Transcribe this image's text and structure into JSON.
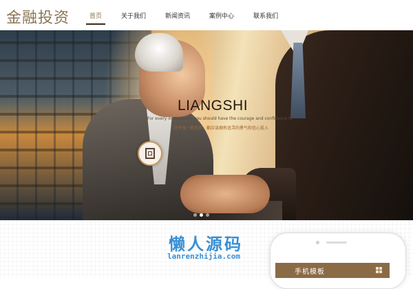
{
  "header": {
    "logo_text": "金融投资",
    "nav": [
      {
        "label": "首页",
        "active": true
      },
      {
        "label": "关于我们",
        "active": false
      },
      {
        "label": "新闻资讯",
        "active": false
      },
      {
        "label": "案例中心",
        "active": false
      },
      {
        "label": "联系我们",
        "active": false
      }
    ]
  },
  "banner": {
    "title": "LIANGSHI",
    "subtitle_en": "For every investment, you should have the courage and confidence to pur",
    "subtitle_cn": "对于每一笔投资，都应该拥有追寻的勇气和信心投入",
    "icon": "logo-seal-icon",
    "slide_count": 3,
    "active_slide": 2
  },
  "watermark": {
    "cn": "懒人源码",
    "en": "lanrenzhijia.com"
  },
  "phone": {
    "screen_title": "手机模板"
  },
  "colors": {
    "accent_gold": "#8b7352",
    "nav_active_bar": "#3b2b1c",
    "watermark_blue": "#3a8fd4",
    "phone_bar": "#8b6b45"
  }
}
